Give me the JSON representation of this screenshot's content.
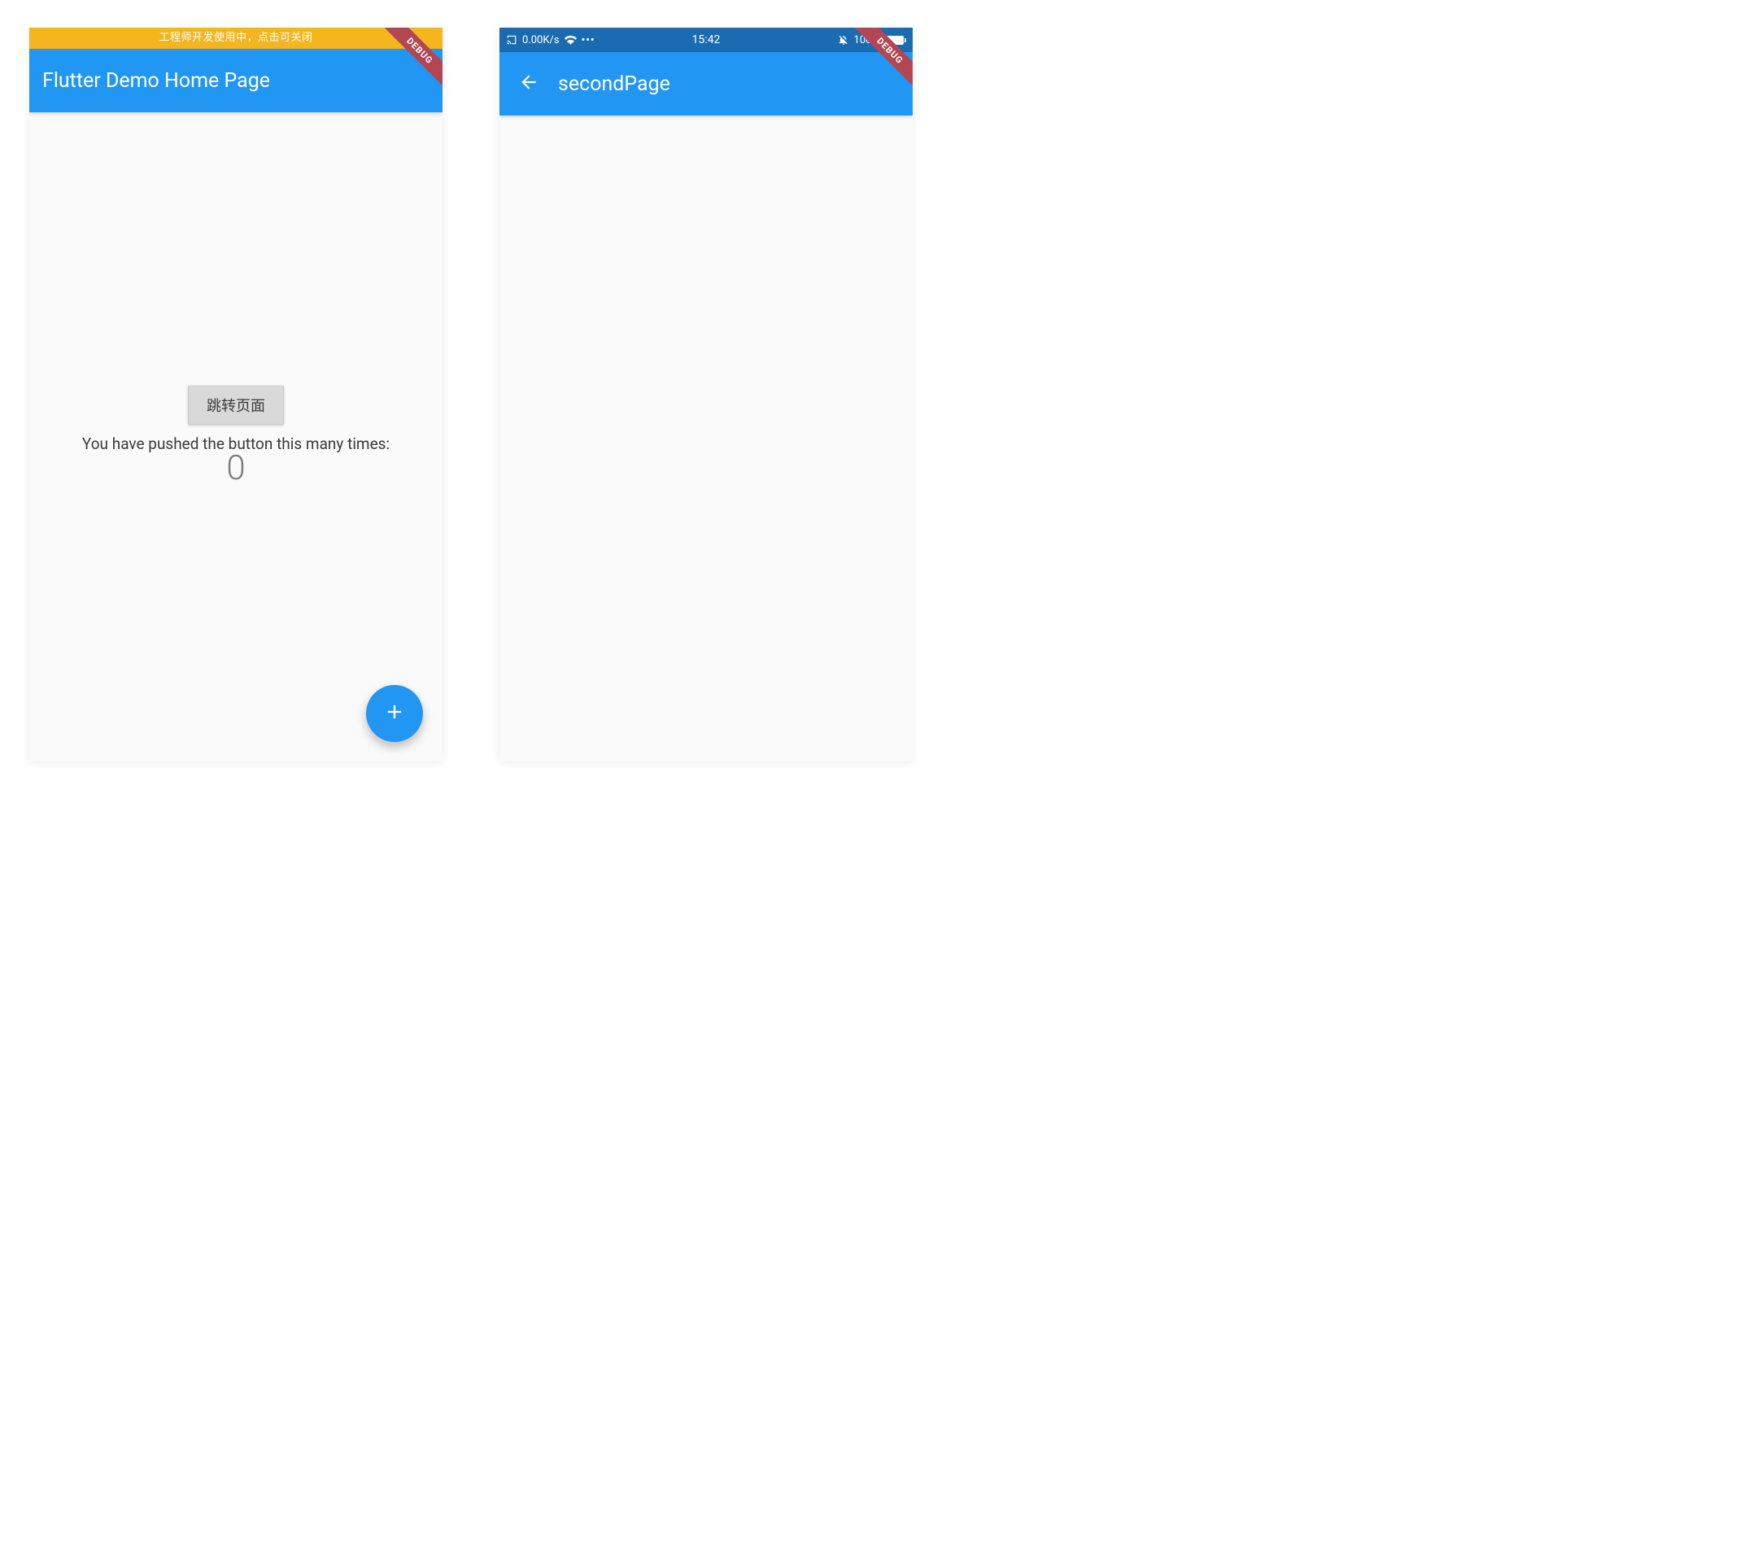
{
  "debug_ribbon": "DEBUG",
  "left": {
    "dev_banner": "工程师开发使用中，点击可关闭",
    "appbar_title": "Flutter Demo Home Page",
    "nav_button_label": "跳转页面",
    "push_text": "You have pushed the button this many times:",
    "counter": "0"
  },
  "right": {
    "status": {
      "net_speed": "0.00K/s",
      "time": "15:42",
      "battery_pct": "100%"
    },
    "appbar_title": "secondPage"
  }
}
